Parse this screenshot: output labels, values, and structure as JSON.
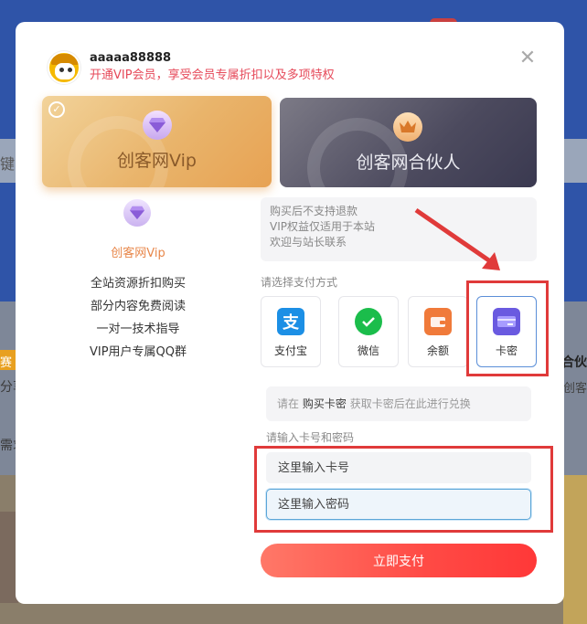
{
  "background": {
    "search_text": "键",
    "left_badge": "赛",
    "left_text_1": "分享",
    "left_text_2": "需求",
    "right_title": "合伙",
    "right_sub": "创客"
  },
  "user": {
    "name": "aaaaa88888",
    "tip": "开通VIP会员，享受会员专属折扣以及多项特权"
  },
  "plans": [
    {
      "label": "创客网Vip",
      "selected": true
    },
    {
      "label": "创客网合伙人",
      "selected": false
    }
  ],
  "vip_detail": {
    "name": "创客网Vip",
    "benefits": [
      "全站资源折扣购买",
      "部分内容免费阅读",
      "一对一技术指导",
      "VIP用户专属QQ群"
    ]
  },
  "notice": [
    "购买后不支持退款",
    "VIP权益仅适用于本站",
    "欢迎与站长联系"
  ],
  "payment": {
    "title": "请选择支付方式",
    "options": [
      {
        "label": "支付宝",
        "icon": "alipay-icon"
      },
      {
        "label": "微信",
        "icon": "wechat-icon"
      },
      {
        "label": "余额",
        "icon": "wallet-icon"
      },
      {
        "label": "卡密",
        "icon": "card-icon",
        "selected": true
      }
    ]
  },
  "redeem": {
    "prefix": "请在",
    "link": "购买卡密",
    "suffix": "获取卡密后在此进行兑换"
  },
  "inputs": {
    "title": "请输入卡号和密码",
    "card_placeholder": "这里输入卡号",
    "password_placeholder": "这里输入密码"
  },
  "submit_label": "立即支付",
  "colors": {
    "accent": "#ff4a45",
    "tip": "#e64a5a",
    "annotation": "#e03a3a",
    "selected_border": "#5b8fd8"
  }
}
